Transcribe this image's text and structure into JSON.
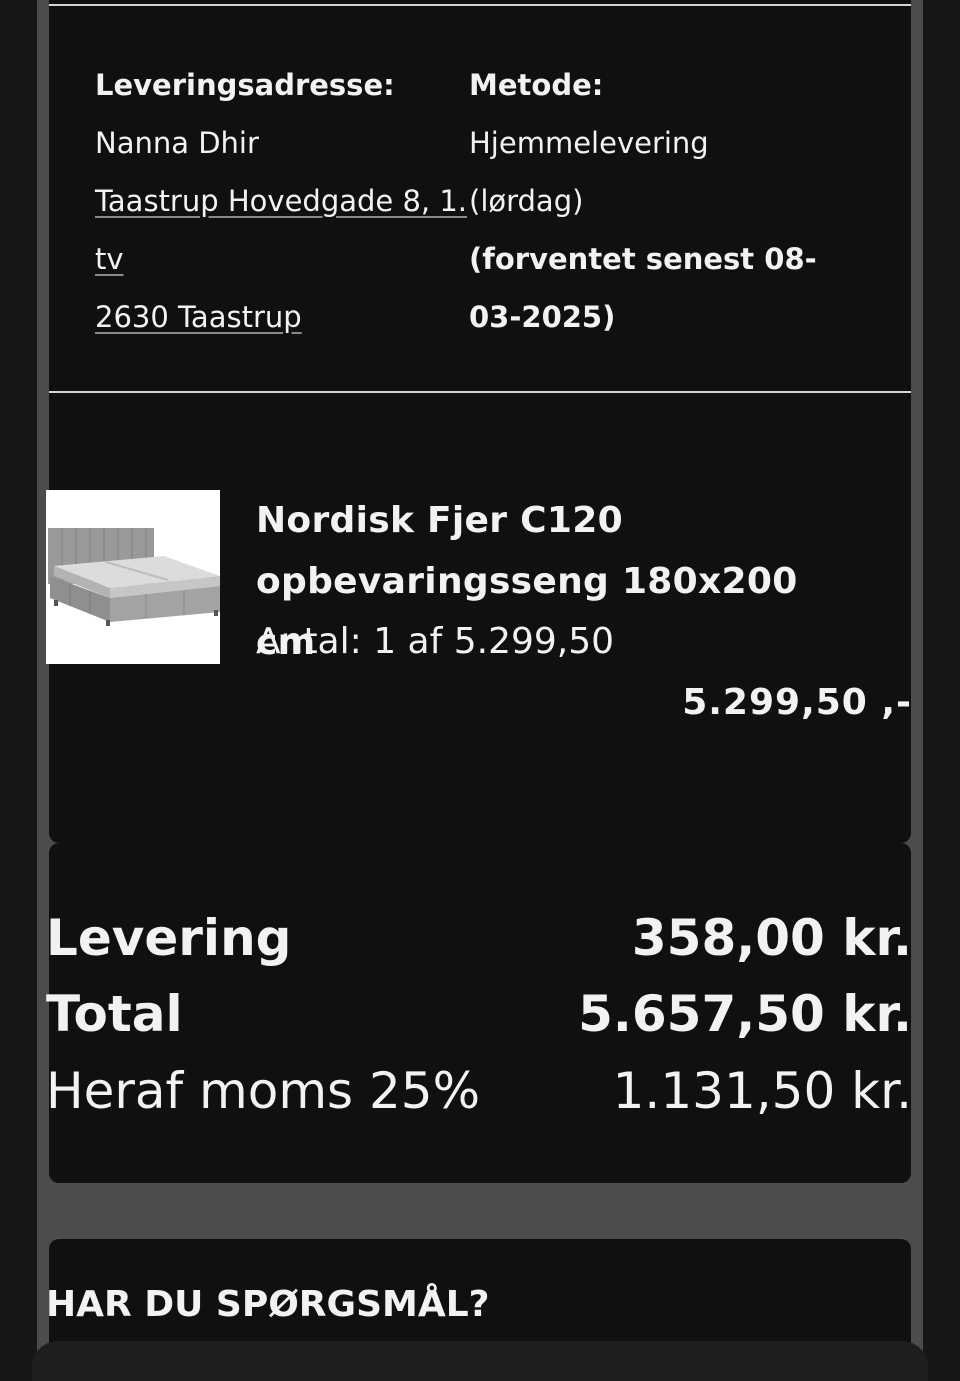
{
  "delivery": {
    "address_label": "Leveringsadresse:",
    "address_name": "Nanna Dhir",
    "address_street_1": "Taastrup Hovedgade 8, 1.",
    "address_street_2": "tv",
    "address_city": "2630 Taastrup",
    "method_label": "Metode:",
    "method_value_1": "Hjemmelevering",
    "method_value_2": "(lørdag)",
    "method_eta_1": "(forventet senest 08-",
    "method_eta_2": "03-2025)"
  },
  "product": {
    "name_line_1": "Nordisk Fjer C120",
    "name_line_2": "opbevaringsseng 180x200 cm",
    "quantity": "Antal: 1 af 5.299,50",
    "price": "5.299,50 ,-",
    "image_icon": "bed-product-image"
  },
  "totals": {
    "delivery_label": "Levering",
    "delivery_value": "358,00 kr.",
    "total_label": "Total",
    "total_value": "5.657,50 kr.",
    "vat_label": "Heraf moms 25%",
    "vat_value": "1.131,50 kr."
  },
  "faq": {
    "title": "HAR DU SPØRGSMÅL?"
  },
  "colors": {
    "background": "#161616",
    "card": "#101010",
    "side_column": "#4b4c4b",
    "text": "#f2f2f2"
  }
}
